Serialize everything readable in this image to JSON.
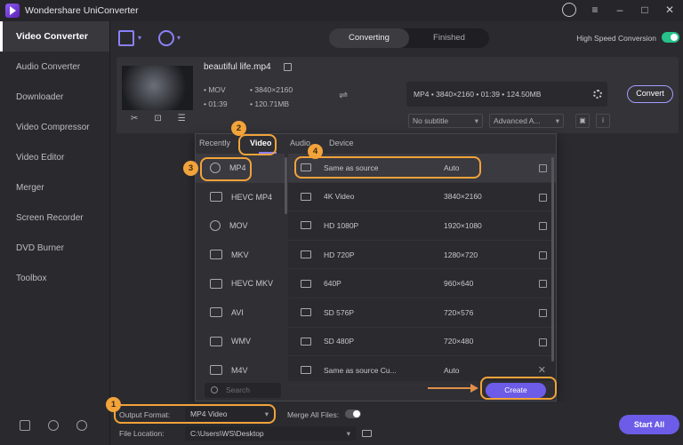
{
  "app": {
    "title": "Wondershare UniConverter"
  },
  "sidebar": {
    "items": [
      {
        "label": "Video Converter"
      },
      {
        "label": "Audio Converter"
      },
      {
        "label": "Downloader"
      },
      {
        "label": "Video Compressor"
      },
      {
        "label": "Video Editor"
      },
      {
        "label": "Merger"
      },
      {
        "label": "Screen Recorder"
      },
      {
        "label": "DVD Burner"
      },
      {
        "label": "Toolbox"
      }
    ]
  },
  "toolbar": {
    "tabs": [
      "Converting",
      "Finished"
    ],
    "active_tab": "Converting",
    "high_speed_label": "High Speed Conversion",
    "high_speed_on": true
  },
  "file": {
    "name": "beautiful life.mp4",
    "format": "MOV",
    "resolution": "3840×2160",
    "duration": "01:39",
    "size": "120.71MB",
    "output": "MP4 • 3840×2160 • 01:39 • 124.50MB",
    "subtitle": "No subtitle",
    "audio": "Advanced A...",
    "convert_label": "Convert"
  },
  "popup": {
    "tabs": [
      "Recently",
      "Video",
      "Audio",
      "Device"
    ],
    "active_tab": "Video",
    "formats": [
      "MP4",
      "HEVC MP4",
      "MOV",
      "MKV",
      "HEVC MKV",
      "AVI",
      "WMV",
      "M4V"
    ],
    "selected_format": "MP4",
    "presets": [
      {
        "name": "Same as source",
        "value": "Auto"
      },
      {
        "name": "4K Video",
        "value": "3840×2160"
      },
      {
        "name": "HD 1080P",
        "value": "1920×1080"
      },
      {
        "name": "HD 720P",
        "value": "1280×720"
      },
      {
        "name": "640P",
        "value": "960×640"
      },
      {
        "name": "SD 576P",
        "value": "720×576"
      },
      {
        "name": "SD 480P",
        "value": "720×480"
      },
      {
        "name": "Same as source Cu...",
        "value": "Auto"
      }
    ],
    "search_placeholder": "Search",
    "create_label": "Create"
  },
  "bottom": {
    "output_format_label": "Output Format:",
    "output_format_value": "MP4 Video",
    "merge_label": "Merge All Files:",
    "merge_on": false,
    "file_location_label": "File Location:",
    "file_location_value": "C:\\Users\\WS\\Desktop",
    "start_all_label": "Start All"
  },
  "callouts": [
    "1",
    "2",
    "3",
    "4"
  ],
  "colors": {
    "accent": "#6c5ce7",
    "highlight": "#f2a33a",
    "toggle_on": "#27c28b"
  }
}
